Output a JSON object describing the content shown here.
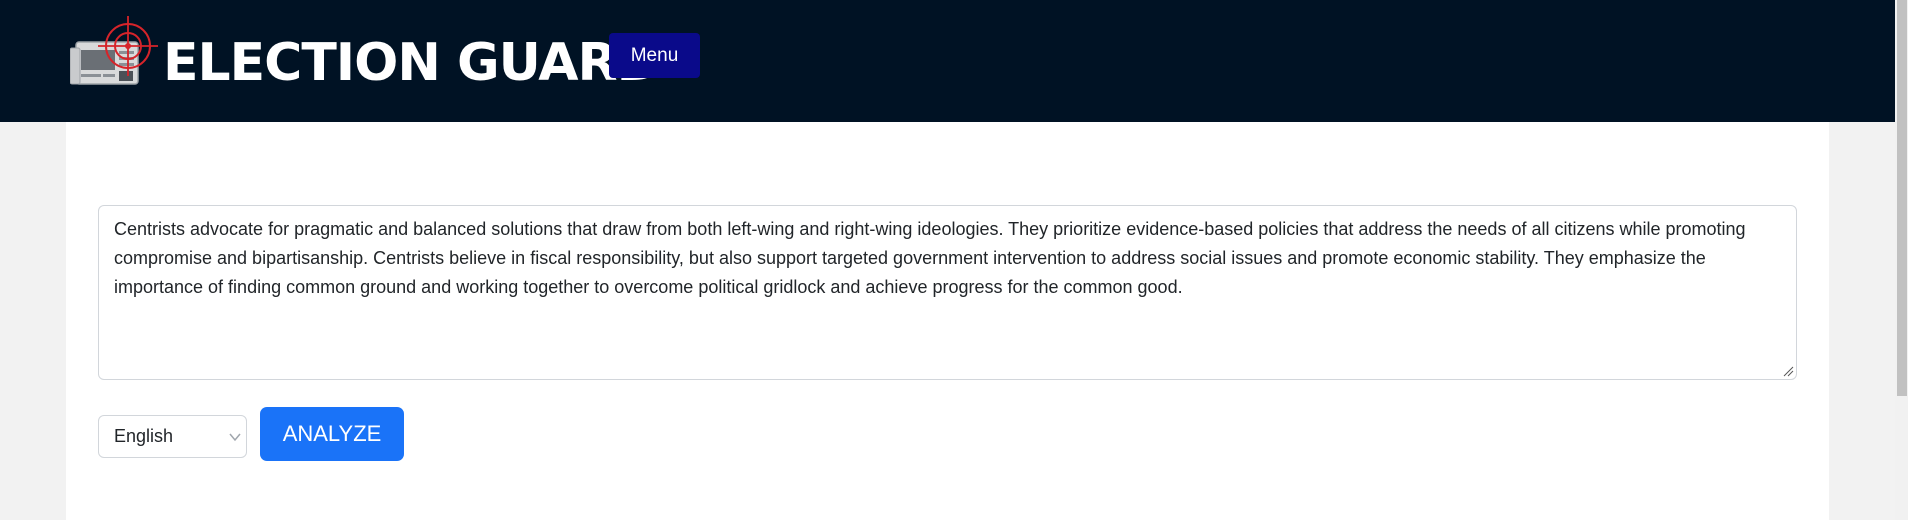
{
  "header": {
    "brand": "ELECTION GUARD",
    "menu_label": "Menu",
    "logo_icon": "newspaper-target-icon",
    "background_color": "#001224",
    "menu_color": "#0a0a8a"
  },
  "main": {
    "text_input": {
      "value": "Centrists advocate for pragmatic and balanced solutions that draw from both left-wing and right-wing ideologies. They prioritize evidence-based policies that address the needs of all citizens while promoting compromise and bipartisanship. Centrists believe in fiscal responsibility, but also support targeted government intervention to address social issues and promote economic stability. They emphasize the importance of finding common ground and working together to overcome political gridlock and achieve progress for the common good."
    },
    "language_select": {
      "selected": "English"
    },
    "analyze_label": "ANALYZE",
    "accent_color": "#1a73f8"
  }
}
